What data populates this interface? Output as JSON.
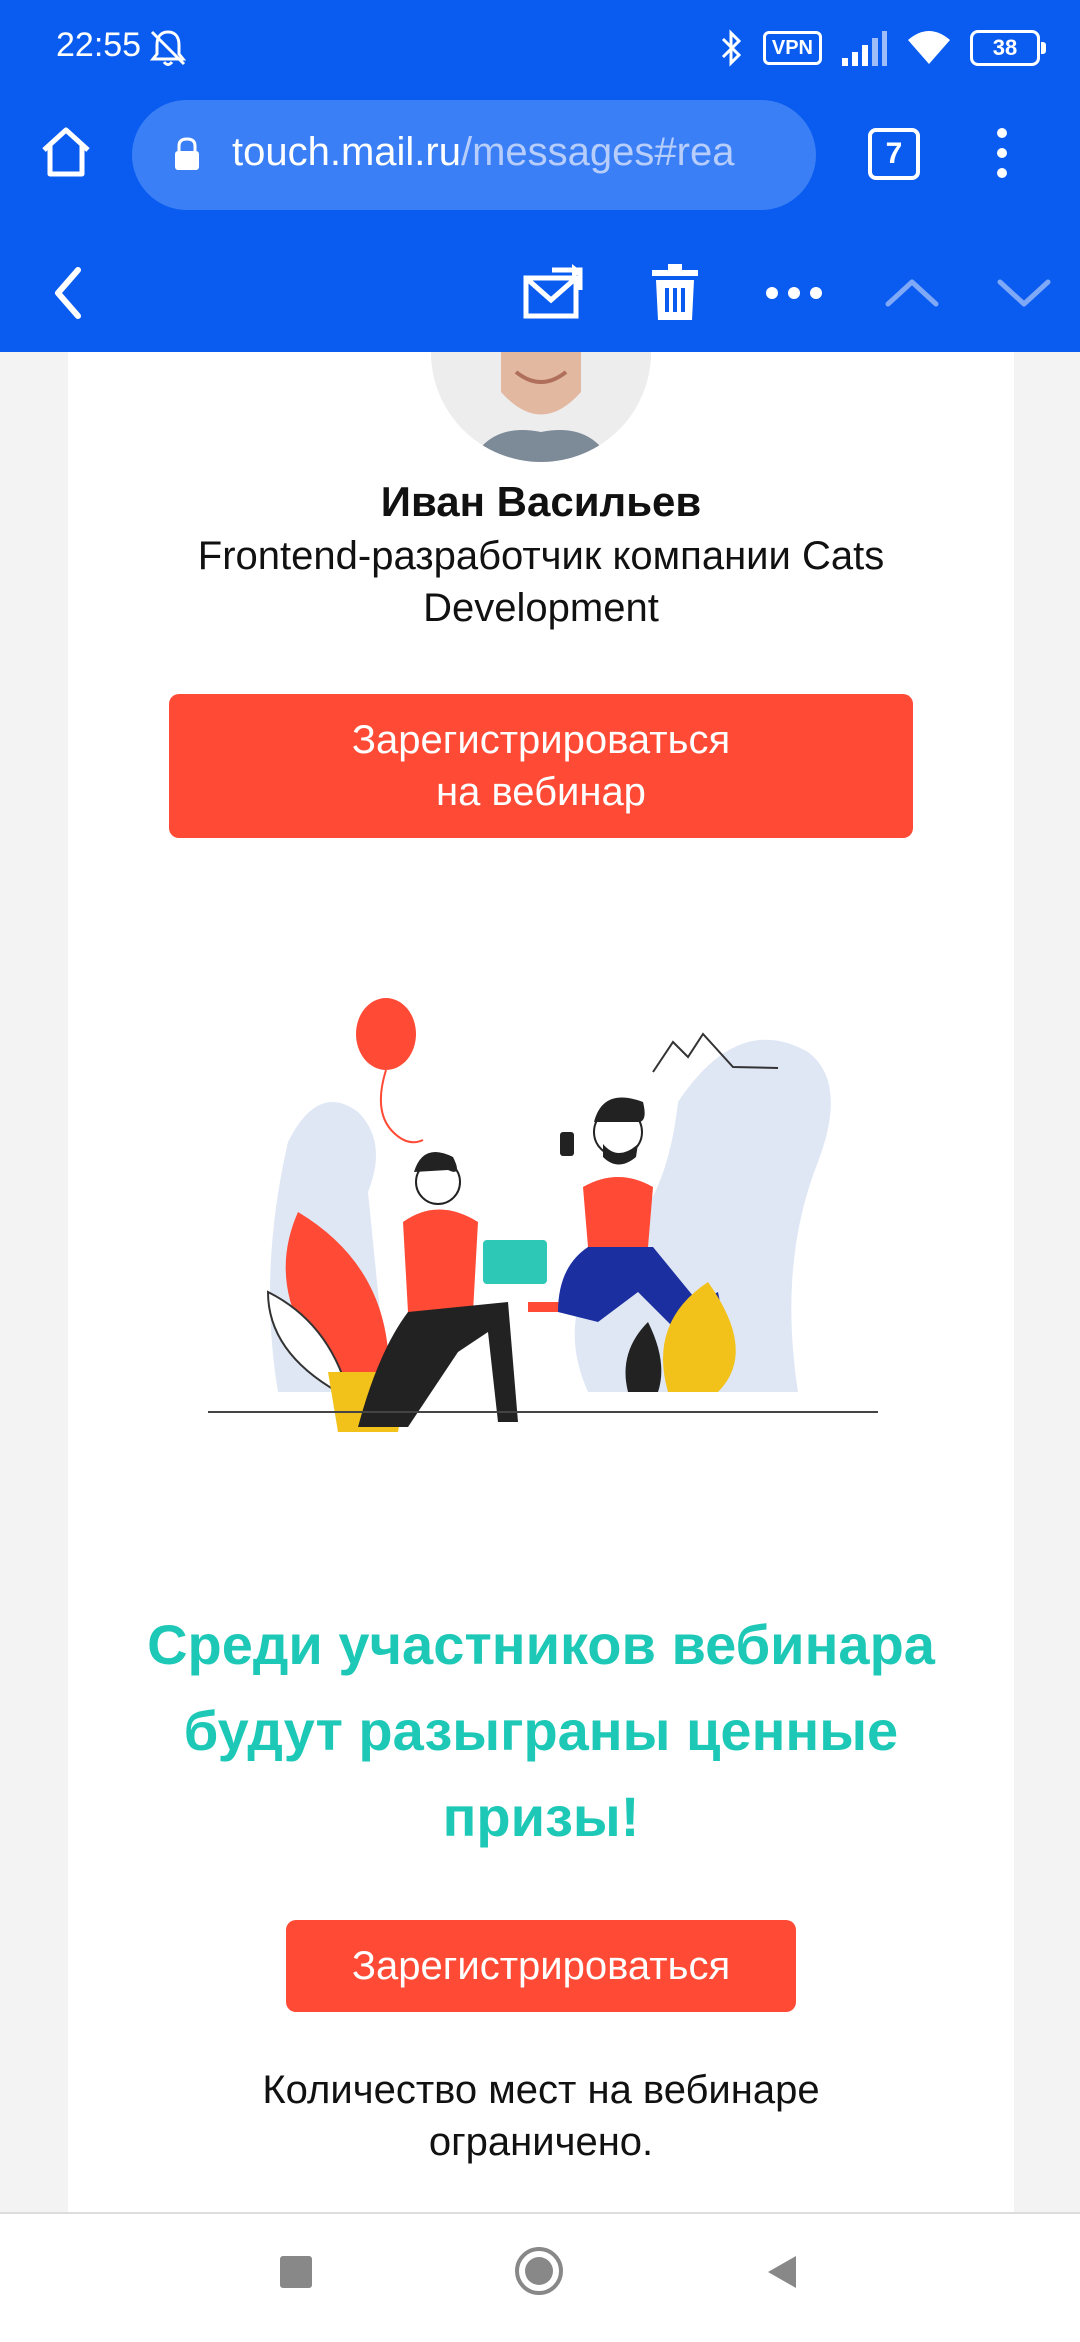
{
  "status_bar": {
    "time": "22:55",
    "vpn_label": "VPN",
    "battery_level": "38"
  },
  "browser": {
    "url_host": "touch.mail.ru",
    "url_path": "/messages#rea",
    "tab_count": "7"
  },
  "mail_toolbar": {
    "icons": [
      "back-icon",
      "move-to-folder-icon",
      "trash-icon",
      "more-icon",
      "previous-icon",
      "next-icon"
    ]
  },
  "speaker": {
    "name": "Иван Васильев",
    "role": "Frontend-разработчик компании Cats Development"
  },
  "cta_primary": {
    "line1": "Зарегистрироваться",
    "line2": "на вебинар"
  },
  "promo_text": "Среди участников вебинара будут разыграны ценные призы!",
  "cta_secondary": {
    "label": "Зарегистрироваться"
  },
  "note": "Количество мест на вебинаре ограничено.",
  "colors": {
    "brand_blue": "#0a5cf0",
    "button_red": "#ff4a35",
    "promo_teal": "#1ec8b6"
  }
}
